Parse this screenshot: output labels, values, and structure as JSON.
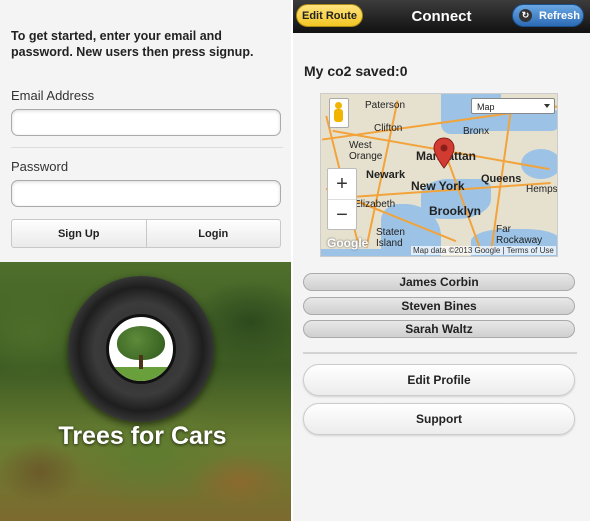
{
  "login": {
    "intro": "To get started, enter your email and password. New users then press signup.",
    "email_label": "Email Address",
    "email_value": "",
    "password_label": "Password",
    "password_value": "",
    "signup_label": "Sign Up",
    "login_label": "Login",
    "brand": "Trees for Cars"
  },
  "main": {
    "header_title": "Connect",
    "edit_route_label": "Edit Route",
    "refresh_label": "Refresh",
    "co2_text": "My co2 saved:0",
    "map": {
      "type_selected": "Map",
      "zoom_in": "+",
      "zoom_out": "−",
      "footer": "Map data ©2013 Google  |  Terms of Use",
      "watermark": "Google",
      "labels": [
        "Paterson",
        "Bronx",
        "Clifton",
        "West Orange",
        "Manhattan",
        "Newark",
        "New York",
        "Queens",
        "Hempstead",
        "Elizabeth",
        "Brooklyn",
        "Far Rockaway",
        "Staten Island"
      ]
    },
    "people": [
      "James Corbin",
      "Steven Bines",
      "Sarah Waltz"
    ],
    "edit_profile_label": "Edit Profile",
    "support_label": "Support"
  },
  "colors": {
    "edit_route_bg": "#f3c623",
    "refresh_bg": "#2b6bb5",
    "header_bg": "#111111",
    "map_marker": "#d23b32"
  }
}
